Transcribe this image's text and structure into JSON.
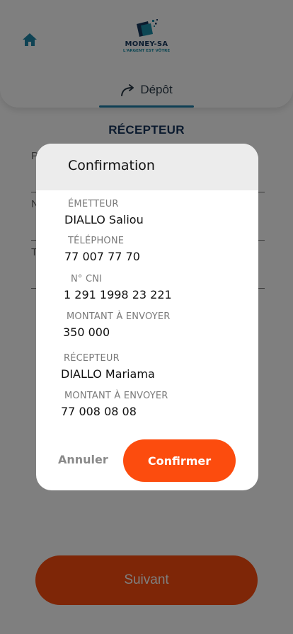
{
  "colors": {
    "accent": "#fc4c0e",
    "brand_dark": "#16385e",
    "brand_teal": "#1a8fa8",
    "tab_underline": "#1f7fa8"
  },
  "header": {
    "home_icon": "home-icon",
    "logo": {
      "name": "MONEY-SA",
      "slogan": "L'ARGENT EST VÔTRE"
    },
    "tab": {
      "icon": "share-arrow-icon",
      "label": "Dépôt"
    }
  },
  "form": {
    "section_title": "RÉCEPTEUR",
    "fields": [
      {
        "label": "P"
      },
      {
        "label": "N"
      },
      {
        "label": "T"
      }
    ],
    "next_label": "Suivant"
  },
  "dialog": {
    "title": "Confirmation",
    "sender_label": "ÉMETTEUR",
    "sender_value": "DIALLO Saliou",
    "phone_label": "TÉLÉPHONE",
    "phone_value": "77 007 77 70",
    "cni_label": "N° CNI",
    "cni_value": "1 291 1998 23 221",
    "amount_label": "MONTANT À ENVOYER",
    "amount_value": "350 000",
    "receiver_label": "RÉCEPTEUR",
    "receiver_value": "DIALLO Mariama",
    "amount2_label": "MONTANT À ENVOYER",
    "amount2_value": "77 008 08 08",
    "cancel_label": "Annuler",
    "confirm_label": "Confirmer"
  }
}
